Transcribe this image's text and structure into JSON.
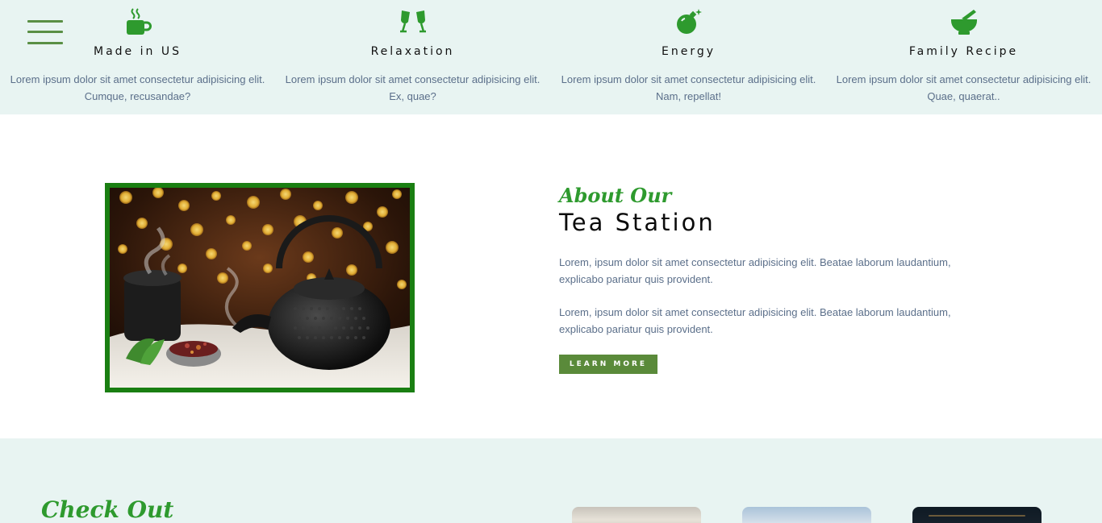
{
  "colors": {
    "accent_green": "#2e9a2e",
    "button_green": "#5a8a3a",
    "frame_green": "#1a7f12",
    "section_bg": "#e8f4f2",
    "body_text": "#5b6f8a"
  },
  "menu": {
    "icon": "hamburger-menu-icon"
  },
  "features": [
    {
      "icon": "coffee-mug-icon",
      "title": "Made in US",
      "desc": "Lorem ipsum dolor sit amet consectetur adipisicing elit. Cumque, recusandae?"
    },
    {
      "icon": "clinking-glasses-icon",
      "title": "Relaxation",
      "desc": "Lorem ipsum dolor sit amet consectetur adipisicing elit. Ex, quae?"
    },
    {
      "icon": "bomb-icon",
      "title": "Energy",
      "desc": "Lorem ipsum dolor sit amet consectetur adipisicing elit. Nam, repellat!"
    },
    {
      "icon": "mortar-pestle-icon",
      "title": "Family Recipe",
      "desc": "Lorem ipsum dolor sit amet consectetur adipisicing elit. Quae, quaerat.."
    }
  ],
  "about": {
    "kicker": "About Our",
    "title": "Tea Station",
    "paragraphs": [
      "Lorem, ipsum dolor sit amet consectetur adipisicing elit. Beatae laborum laudantium, explicabo pariatur quis provident.",
      "Lorem, ipsum dolor sit amet consectetur adipisicing elit. Beatae laborum laudantium, explicabo pariatur quis provident."
    ],
    "button_label": "LEARN MORE"
  },
  "checkout": {
    "title": "Check Out"
  }
}
